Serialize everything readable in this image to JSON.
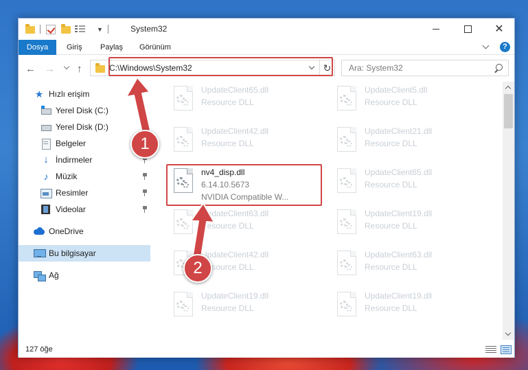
{
  "window": {
    "title": "System32",
    "controls": {
      "minimize": "minimize-icon",
      "maximize": "maximize-icon",
      "close": "✕"
    }
  },
  "ribbon": {
    "tabs": [
      "Dosya",
      "Giriş",
      "Paylaş",
      "Görünüm"
    ],
    "help": "?"
  },
  "navigation": {
    "back": "←",
    "forward": "→",
    "up": "↑",
    "address": "C:\\Windows\\System32",
    "refresh": "↻",
    "search_placeholder": "Ara: System32"
  },
  "sidebar": {
    "items": [
      {
        "label": "Hızlı erişim",
        "icon": "star-icon"
      },
      {
        "label": "Yerel Disk (C:)",
        "icon": "drive-c-icon"
      },
      {
        "label": "Yerel Disk (D:)",
        "icon": "drive-d-icon"
      },
      {
        "label": "Belgeler",
        "icon": "documents-icon"
      },
      {
        "label": "İndirmeler",
        "icon": "downloads-icon"
      },
      {
        "label": "Müzik",
        "icon": "music-icon"
      },
      {
        "label": "Resimler",
        "icon": "pictures-icon"
      },
      {
        "label": "Videolar",
        "icon": "videos-icon"
      },
      {
        "label": "OneDrive",
        "icon": "onedrive-icon"
      },
      {
        "label": "Bu bilgisayar",
        "icon": "this-pc-icon",
        "selected": true
      },
      {
        "label": "Ağ",
        "icon": "network-icon"
      }
    ]
  },
  "files": {
    "items": [
      {
        "name": "UpdateClient65.dll",
        "desc": "Resource DLL"
      },
      {
        "name": "UpdateClient5.dll",
        "desc": "Resource DLL"
      },
      {
        "name": "UpdateClient42.dll",
        "desc": "Resource DLL"
      },
      {
        "name": "UpdateClient21.dll",
        "desc": "Resource DLL"
      },
      {
        "name": "nv4_disp.dll",
        "desc": "6.14.10.5673",
        "desc2": "NVIDIA Compatible W...",
        "highlighted": true
      },
      {
        "name": "UpdateClient65.dll",
        "desc": "Resource DLL"
      },
      {
        "name": "UpdateClient63.dll",
        "desc": "Resource DLL"
      },
      {
        "name": "UpdateClient19.dll",
        "desc": "Resource DLL"
      },
      {
        "name": "UpdateClient42.dll",
        "desc": "Resource DLL"
      },
      {
        "name": "UpdateClient63.dll",
        "desc": "Resource DLL"
      },
      {
        "name": "UpdateClient19.dll",
        "desc": "Resource DLL"
      },
      {
        "name": "UpdateClient19.dll",
        "desc": "Resource DLL"
      }
    ]
  },
  "status": {
    "count": "127 öğe"
  },
  "callouts": [
    "1",
    "2"
  ],
  "colors": {
    "accent": "#1979ca",
    "highlight": "#d04545",
    "selected_bg": "#cce2f5"
  }
}
